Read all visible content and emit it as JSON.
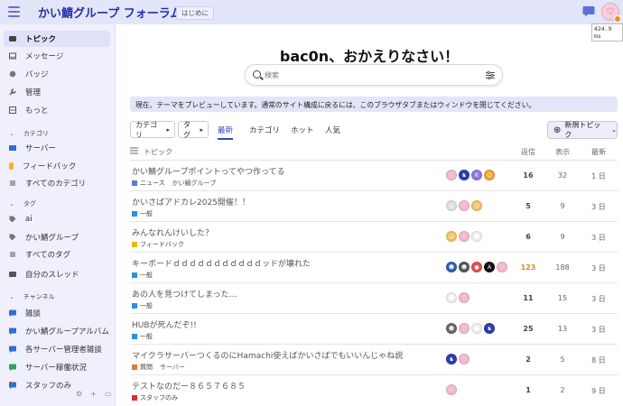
{
  "header": {
    "site_title": "かい鯖グループ フォーラム",
    "intro_badge": "はじめに",
    "timing": "424.9 ms"
  },
  "sidebar": {
    "top_items": [
      {
        "label": "トピック",
        "icon": "topics-icon",
        "active": true
      },
      {
        "label": "メッセージ",
        "icon": "inbox-icon",
        "active": false
      },
      {
        "label": "バッジ",
        "icon": "badge-icon",
        "active": false
      },
      {
        "label": "管理",
        "icon": "wrench-icon",
        "active": false
      },
      {
        "label": "もっと",
        "icon": "more-icon",
        "active": false
      }
    ],
    "categories_header": "カテゴリ",
    "categories": [
      {
        "label": "サーバー",
        "color": "#2f6fd6"
      },
      {
        "label": "フィードバック",
        "color": "#f2b51c"
      },
      {
        "label": "すべてのカテゴリ",
        "color": "#888888"
      }
    ],
    "tags_header": "タグ",
    "tags": [
      {
        "label": "ai"
      },
      {
        "label": "かい鯖グループ"
      },
      {
        "label": "すべてのタグ"
      }
    ],
    "my_threads": "自分のスレッド",
    "channels_header": "チャンネル",
    "channels": [
      {
        "label": "雑談",
        "color": "#2f6fd6"
      },
      {
        "label": "かい鯖グループアルバム",
        "color": "#2f6fd6"
      },
      {
        "label": "各サーバー管理者雑談",
        "color": "#2f6fd6"
      },
      {
        "label": "サーバー稼働状況",
        "color": "#27a65a"
      },
      {
        "label": "スタッフのみ",
        "color": "#2f6fd6"
      }
    ]
  },
  "main": {
    "welcome": "bac0n、おかえりなさい！",
    "search_placeholder": "検索",
    "notice": "現在、テーマをプレビューしています。通常のサイト構成に戻るには、このブラウザタブまたはウィンドウを閉じてください。",
    "filters": {
      "category": "カテゴリ",
      "tag": "タグ",
      "links": [
        "最新",
        "カテゴリ",
        "ホット",
        "人気"
      ],
      "active_link": "最新",
      "new_topic": "新規トピック"
    },
    "columns": {
      "topic": "トピック",
      "replies": "返信",
      "views": "表示",
      "activity": "最新"
    }
  },
  "topics": [
    {
      "title": "かい鯖グループポイントってやつ作ってる",
      "category": "ニュース",
      "category_color": "#5b7cd6",
      "tag": "かい鯖グループ",
      "replies": "16",
      "views": "32",
      "activity": "1 日",
      "hot": false,
      "posters": [
        {
          "c": "#f2b8cc",
          "t": "♡"
        },
        {
          "c": "#2a3fa8",
          "t": "♞"
        },
        {
          "c": "#8a7be0",
          "t": "K"
        },
        {
          "c": "#f0a030",
          "t": "☺"
        }
      ]
    },
    {
      "title": "かいさばアドカレ2025開催！！",
      "category": "一般",
      "category_color": "#2f8fe0",
      "tag": "",
      "replies": "5",
      "views": "9",
      "activity": "3 日",
      "hot": false,
      "posters": [
        {
          "c": "#dddddd",
          "t": "☺"
        },
        {
          "c": "#f2b8cc",
          "t": "♡"
        },
        {
          "c": "#f0c060",
          "t": "☺"
        }
      ]
    },
    {
      "title": "みんなれんけいした？",
      "category": "フィードバック",
      "category_color": "#f2b51c",
      "tag": "",
      "replies": "6",
      "views": "9",
      "activity": "3 日",
      "hot": false,
      "posters": [
        {
          "c": "#f0c060",
          "t": "☺"
        },
        {
          "c": "#f2b8cc",
          "t": "♡"
        },
        {
          "c": "#eeeeee",
          "t": "☻"
        }
      ]
    },
    {
      "title": "キーボードｄｄｄｄｄｄｄｄｄｄｄッドが壊れた",
      "category": "一般",
      "category_color": "#2f8fe0",
      "tag": "",
      "replies": "123",
      "views": "188",
      "activity": "3 日",
      "hot": true,
      "posters": [
        {
          "c": "#2a5fb0",
          "t": "☻"
        },
        {
          "c": "#555555",
          "t": "☻"
        },
        {
          "c": "#e05050",
          "t": "●"
        },
        {
          "c": "#111111",
          "t": "A"
        },
        {
          "c": "#f2b8cc",
          "t": "♡"
        }
      ]
    },
    {
      "title": "あの人を見つけてしまった…",
      "category": "一般",
      "category_color": "#2f8fe0",
      "tag": "",
      "replies": "11",
      "views": "15",
      "activity": "3 日",
      "hot": false,
      "posters": [
        {
          "c": "#eeeeee",
          "t": "☻"
        },
        {
          "c": "#f2b8cc",
          "t": "♡"
        }
      ]
    },
    {
      "title": "HUBが死んだぞ!!",
      "category": "一般",
      "category_color": "#2f8fe0",
      "tag": "",
      "replies": "25",
      "views": "13",
      "activity": "3 日",
      "hot": false,
      "posters": [
        {
          "c": "#666666",
          "t": "☻"
        },
        {
          "c": "#f2b8cc",
          "t": "♡"
        },
        {
          "c": "#eeeeee",
          "t": "☻"
        },
        {
          "c": "#2a3fa8",
          "t": "♞"
        }
      ]
    },
    {
      "title": "マイクラサーバーつくるのにHamachi使えばかいさばでもいいんじゃね説",
      "category": "質問",
      "category_color": "#e27a30",
      "tag": "サーバー",
      "replies": "2",
      "views": "5",
      "activity": "8 日",
      "hot": false,
      "posters": [
        {
          "c": "#2a3fa8",
          "t": "♞"
        },
        {
          "c": "#f2b8cc",
          "t": "♡"
        }
      ]
    },
    {
      "title": "テストなのだー８６５７６８５",
      "category": "スタッフのみ",
      "category_color": "#d63030",
      "tag": "",
      "replies": "1",
      "views": "2",
      "activity": "9 日",
      "hot": false,
      "posters": [
        {
          "c": "#f2b8cc",
          "t": "♡"
        }
      ]
    }
  ]
}
